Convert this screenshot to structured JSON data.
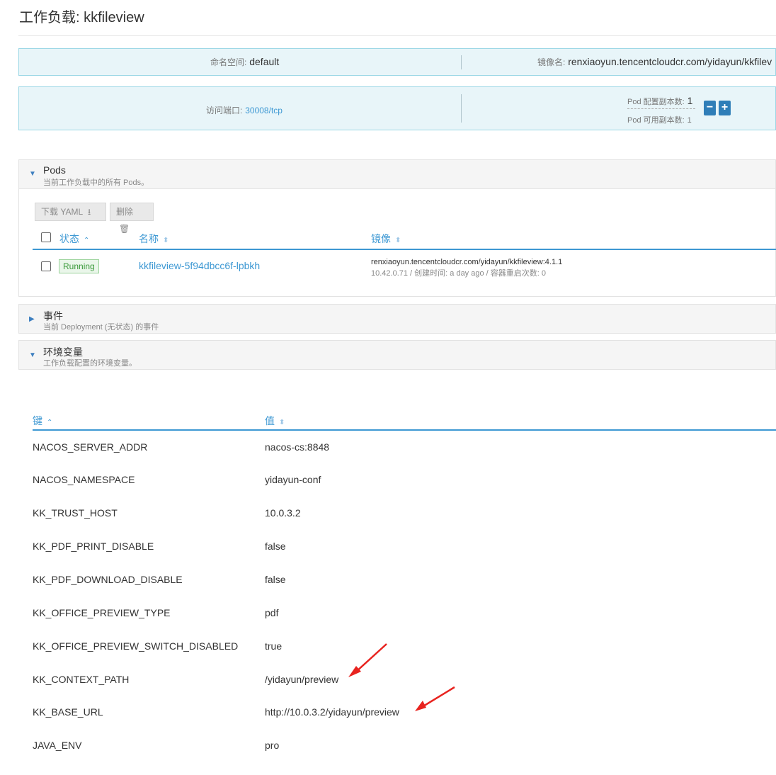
{
  "page": {
    "title": "工作负载: kkfileview"
  },
  "info": {
    "namespace_label": "命名空间:",
    "namespace_value": "default",
    "image_label": "镜像名:",
    "image_value": "renxiaoyun.tencentcloudcr.com/yidayun/kkfilev",
    "port_label": "访问端口:",
    "port_value": "30008/tcp",
    "replicas_config_label": "Pod 配置副本数:",
    "replicas_config_value": "1",
    "replicas_available_label": "Pod 可用副本数:",
    "replicas_available_value": "1",
    "minus_label": "−",
    "plus_label": "+"
  },
  "pods": {
    "title": "Pods",
    "subtitle": "当前工作负载中的所有 Pods。",
    "download_label": "下载 YAML",
    "delete_label": "删除",
    "columns": [
      "状态",
      "名称",
      "镜像"
    ],
    "rows": [
      {
        "status": "Running",
        "name": "kkfileview-5f94dbcc6f-lpbkh",
        "image": "renxiaoyun.tencentcloudcr.com/yidayun/kkfileview:4.1.1",
        "meta": "10.42.0.71 / 创建时间: a day ago / 容器重启次数: 0"
      }
    ]
  },
  "events": {
    "title": "事件",
    "subtitle": "当前 Deployment (无状态) 的事件"
  },
  "env": {
    "title": "环境变量",
    "subtitle": "工作负载配置的环境变量。",
    "col_key": "键",
    "col_value": "值",
    "rows": [
      {
        "key": "NACOS_SERVER_ADDR",
        "value": "nacos-cs:8848"
      },
      {
        "key": "NACOS_NAMESPACE",
        "value": "yidayun-conf"
      },
      {
        "key": "KK_TRUST_HOST",
        "value": "10.0.3.2"
      },
      {
        "key": "KK_PDF_PRINT_DISABLE",
        "value": "false"
      },
      {
        "key": "KK_PDF_DOWNLOAD_DISABLE",
        "value": "false"
      },
      {
        "key": "KK_OFFICE_PREVIEW_TYPE",
        "value": "pdf"
      },
      {
        "key": "KK_OFFICE_PREVIEW_SWITCH_DISABLED",
        "value": "true"
      },
      {
        "key": "KK_CONTEXT_PATH",
        "value": "/yidayun/preview"
      },
      {
        "key": "KK_BASE_URL",
        "value": "http://10.0.3.2/yidayun/preview"
      },
      {
        "key": "JAVA_ENV",
        "value": "pro"
      }
    ]
  },
  "colors": {
    "accent": "#3d98d3",
    "info_bg": "#e8f5f9",
    "running_green": "#3b9a3b",
    "annotation_red": "#e8231f"
  }
}
